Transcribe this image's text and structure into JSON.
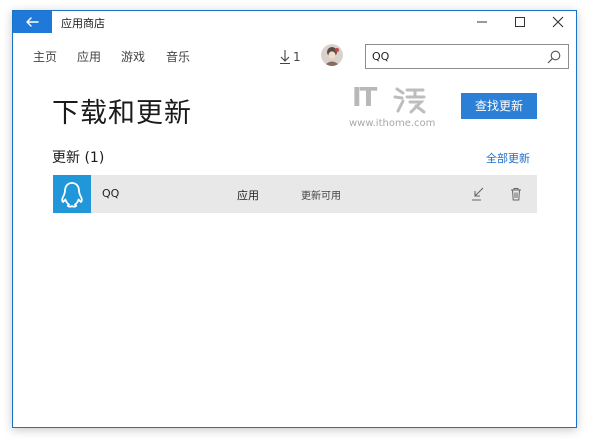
{
  "window": {
    "title": "应用商店",
    "minimize_glyph": "—",
    "maximize_glyph": "☐",
    "close_glyph": "✕"
  },
  "nav": {
    "tabs": [
      {
        "label": "主页"
      },
      {
        "label": "应用"
      },
      {
        "label": "游戏"
      },
      {
        "label": "音乐"
      }
    ],
    "download_count": "1"
  },
  "search": {
    "value": "QQ",
    "icon": "search-icon"
  },
  "page": {
    "title": "下载和更新",
    "check_button": "查找更新"
  },
  "watermark": {
    "text": "IT",
    "url": "www.ithome.com"
  },
  "updates": {
    "section_title": "更新 (1)",
    "update_all": "全部更新",
    "items": [
      {
        "name": "QQ",
        "type": "应用",
        "status": "更新可用",
        "icon": "qq-penguin-icon"
      }
    ]
  },
  "colors": {
    "accent": "#2b7fd6",
    "back_button": "#1f79d9",
    "window_border": "#1a73c8",
    "app_tile": "#2196d9",
    "row_background": "#e8e8e8",
    "link": "#1f6fc5"
  }
}
